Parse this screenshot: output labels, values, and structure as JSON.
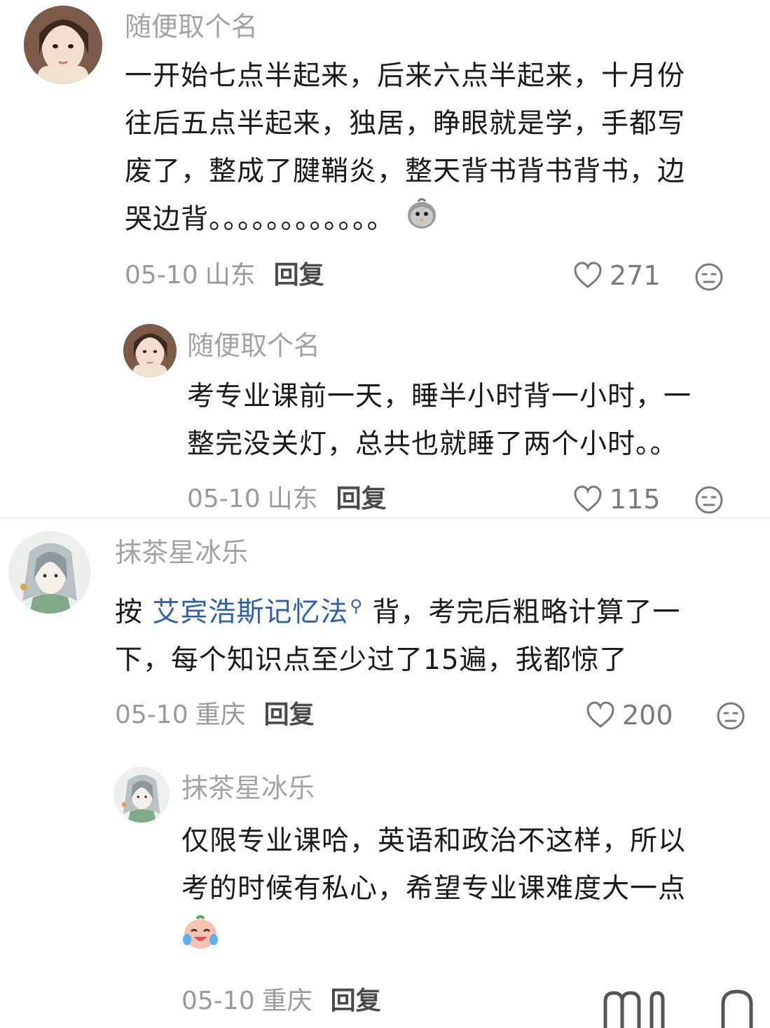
{
  "comments": [
    {
      "username": "随便取个名",
      "lines": [
        "一开始七点半起来，后来六点半起来，十月份",
        "往后五点半起来，独居，睁眼就是学，手都写",
        "废了，整成了腱鞘炎，整天背书背书背书，边",
        "哭边背。。。。。。。。。。。。"
      ],
      "date": "05-10",
      "location": "山东",
      "reply_label": "回复",
      "likes": "271",
      "emoji": "crying-chick-emoji",
      "reply": {
        "username": "随便取个名",
        "lines": [
          "考专业课前一天，睡半小时背一小时，一",
          "整完没关灯，总共也就睡了两个小时。。"
        ],
        "date": "05-10",
        "location": "山东",
        "reply_label": "回复",
        "likes": "115"
      }
    },
    {
      "username": "抹茶星冰乐",
      "line1_prefix": "按 ",
      "topic_link": "艾宾浩斯记忆法",
      "line1_suffix": " 背，考完后粗略计算了一",
      "line2": "下，每个知识点至少过了15遍，我都惊了",
      "date": "05-10",
      "location": "重庆",
      "reply_label": "回复",
      "likes": "200",
      "reply": {
        "username": "抹茶星冰乐",
        "lines": [
          "仅限专业课哈，英语和政治不这样，所以",
          "考的时候有私心，希望专业课难度大一点"
        ],
        "emoji": "crying-laughing-emoji",
        "date": "05-10",
        "location": "重庆",
        "reply_label": "回复"
      }
    }
  ],
  "icons": {
    "like": "heart-outline-icon",
    "dislike": "neutral-face-icon"
  },
  "colors": {
    "link": "#2f5fa8",
    "username": "#a3a3a3",
    "text": "#1a1a1a",
    "meta": "#9a9a9a"
  }
}
